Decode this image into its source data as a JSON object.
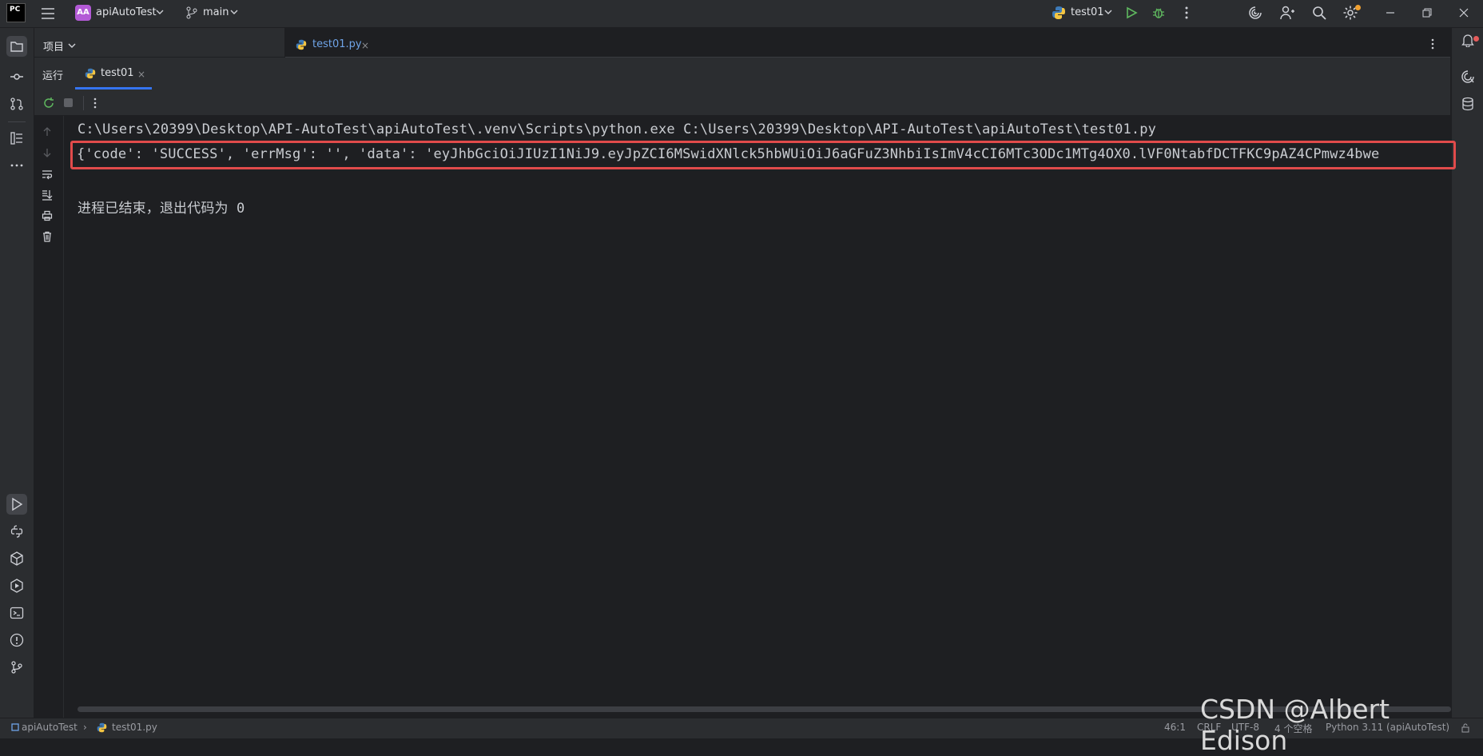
{
  "titlebar": {
    "logo_text": "PC",
    "project_badge": "AA",
    "project_name": "apiAutoTest",
    "branch": "main",
    "run_config": "test01"
  },
  "project_panel": {
    "label": "项目"
  },
  "editor": {
    "tabs": [
      {
        "label": "test01.py",
        "close": "×"
      }
    ]
  },
  "run_window": {
    "title": "运行",
    "tab_label": "test01",
    "tab_close": "×"
  },
  "console": {
    "lines": [
      "C:\\Users\\20399\\Desktop\\API-AutoTest\\apiAutoTest\\.venv\\Scripts\\python.exe C:\\Users\\20399\\Desktop\\API-AutoTest\\apiAutoTest\\test01.py",
      "{'code': 'SUCCESS', 'errMsg': '', 'data': 'eyJhbGciOiJIUzI1NiJ9.eyJpZCI6MSwidXNlck5hbWUiOiJ6aGFuZ3NhbiIsImV4cCI6MTc3ODc1MTg4OX0.lVF0NtabfDCTFKC9pAZ4CPmwz4bwe",
      "进程已结束，退出代码为 0"
    ]
  },
  "statusbar": {
    "breadcrumb_project": "apiAutoTest",
    "breadcrumb_sep": "›",
    "breadcrumb_file": "test01.py",
    "position": "46:1",
    "line_ending": "CRLF",
    "encoding": "UTF-8",
    "indent": "4 个空格",
    "interpreter": "Python 3.11 (apiAutoTest)"
  },
  "watermark": "CSDN @Albert Edison",
  "colors": {
    "accent": "#3574f0",
    "highlight_box": "#e14b4b",
    "run_green": "#5fb85f",
    "project_badge": "#b35ad6",
    "file_tab_text": "#6fa4e8"
  },
  "icons": {
    "left_strip": [
      "folder-icon",
      "commit-icon",
      "pull-request-icon",
      "structure-icon",
      "more-icon",
      "run-icon",
      "python-console-icon",
      "python-packages-icon",
      "services-icon",
      "terminal-icon",
      "problems-icon",
      "git-icon"
    ],
    "right_strip": [
      "notifications-icon",
      "ai-assistant-icon",
      "database-icon"
    ]
  }
}
